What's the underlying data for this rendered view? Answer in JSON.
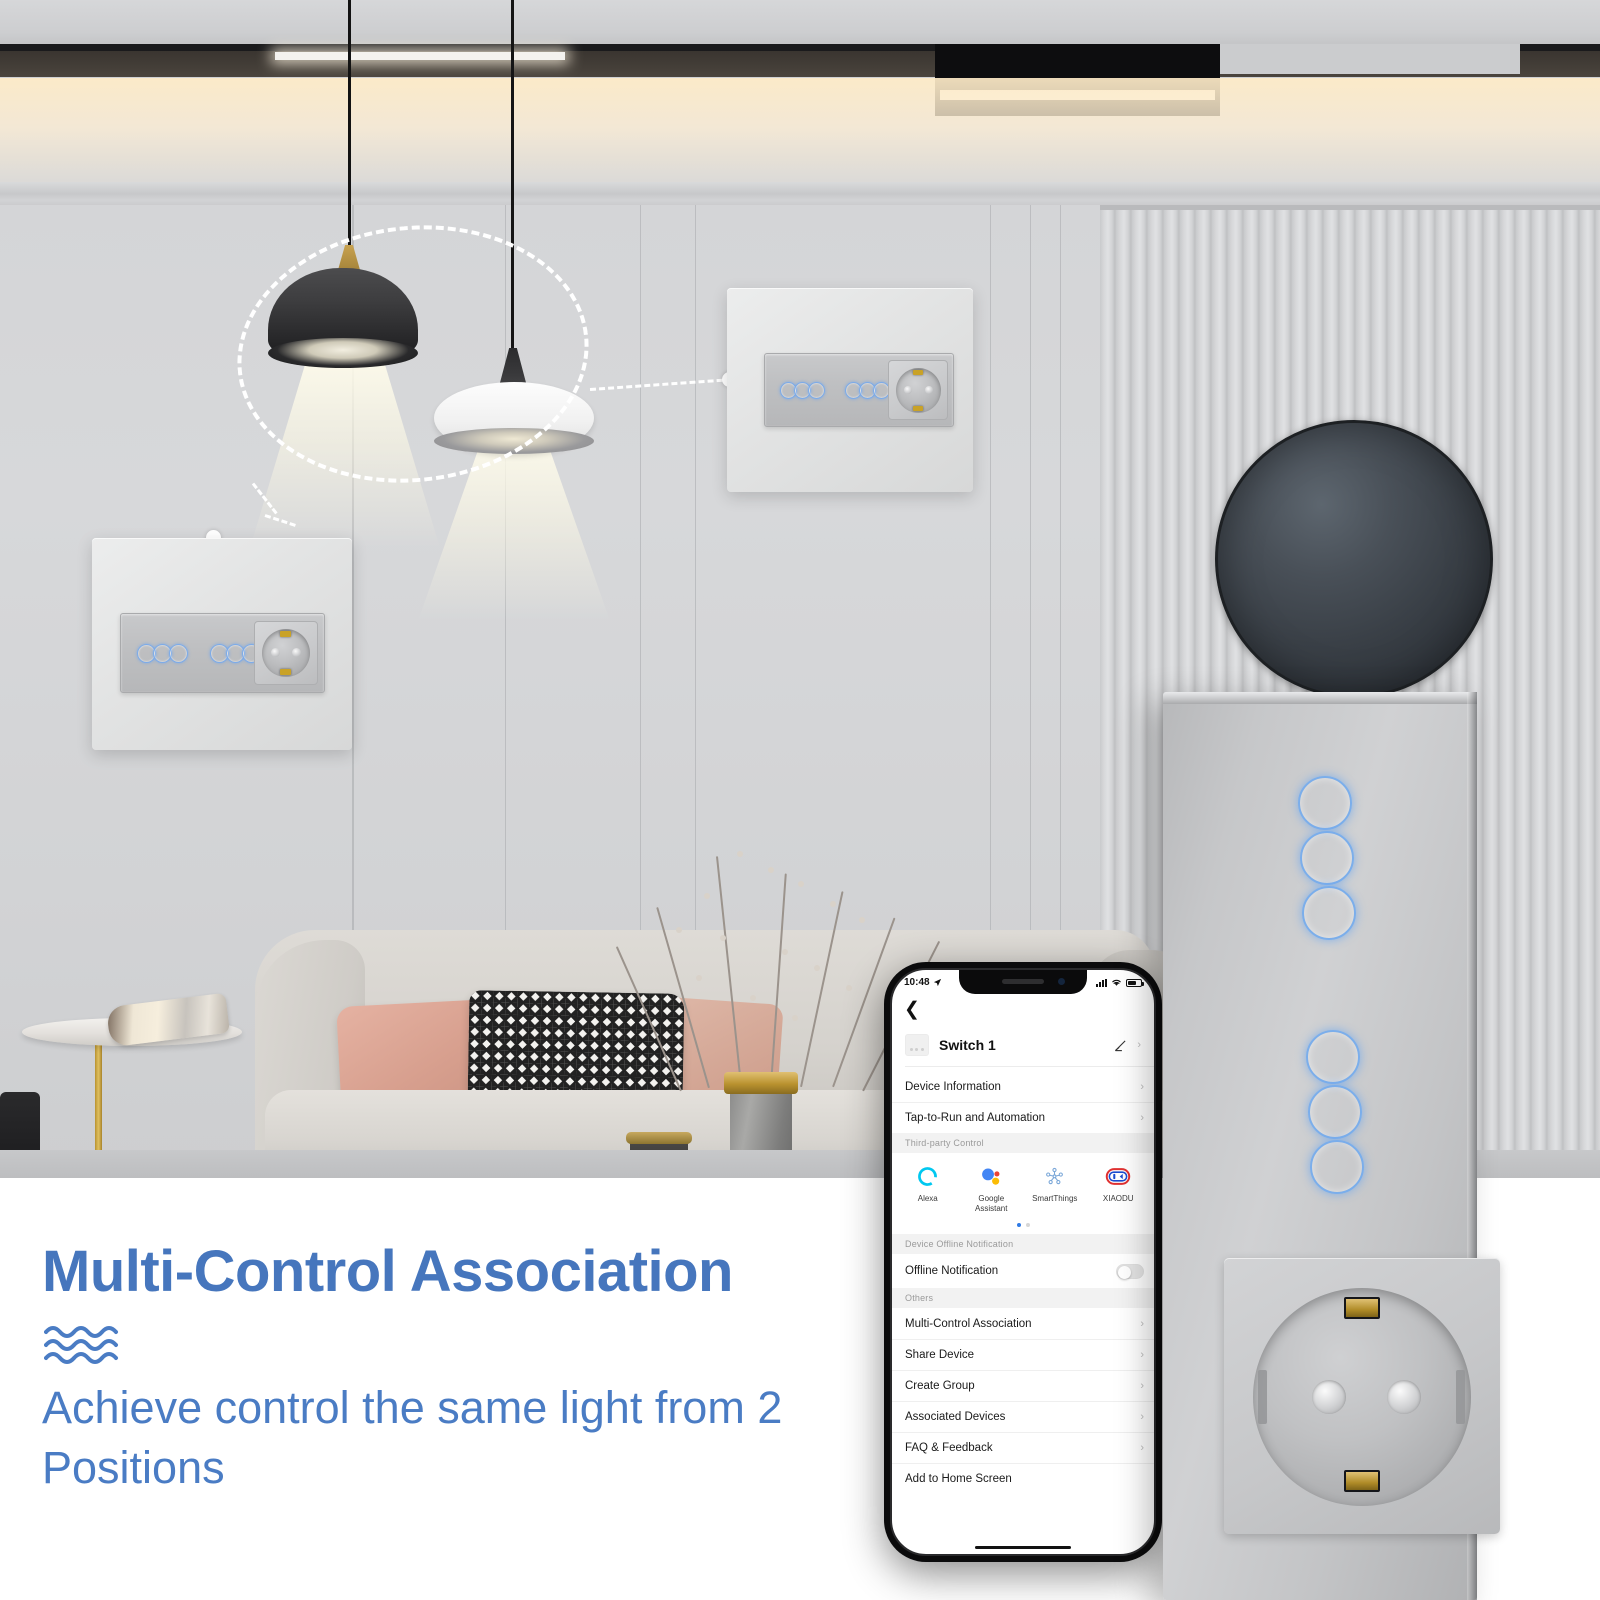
{
  "marketing": {
    "headline": "Multi-Control Association",
    "subline": "Achieve control the same light from 2 Positions",
    "wave_icon": "wave-lines-icon",
    "accent_color": "#4676bd",
    "subline_color": "#4a7cc4"
  },
  "phone": {
    "status_bar": {
      "time": "10:48",
      "location_icon": "location-arrow-icon",
      "signal_icon": "cellular-signal-icon",
      "wifi_icon": "wifi-icon",
      "battery_icon": "battery-icon"
    },
    "back_icon": "chevron-left-icon",
    "device": {
      "thumbnail_icon": "switch-panel-thumbnail-icon",
      "name": "Switch 1",
      "edit_icon": "pencil-edit-icon",
      "chevron": "›"
    },
    "rows_top": [
      {
        "label": "Device Information",
        "chevron": "›"
      },
      {
        "label": "Tap-to-Run and Automation",
        "chevron": "›"
      }
    ],
    "third_party": {
      "header": "Third-party Control",
      "items": [
        {
          "label": "Alexa",
          "icon": "alexa-icon",
          "color": "#00c8f0"
        },
        {
          "label": "Google Assistant",
          "icon": "google-assistant-icon",
          "color": "#4285f4"
        },
        {
          "label": "SmartThings",
          "icon": "smartthings-icon",
          "color": "#a8c8ea"
        },
        {
          "label": "XIAODU",
          "icon": "xiaodu-icon",
          "color": "#e03030"
        }
      ],
      "page_dots": 2,
      "active_dot": 0
    },
    "offline": {
      "header": "Device Offline Notification",
      "label": "Offline Notification",
      "toggle_state": "off",
      "toggle_icon": "toggle-switch-icon"
    },
    "others": {
      "header": "Others",
      "items": [
        {
          "label": "Multi-Control Association",
          "chevron": "›"
        },
        {
          "label": "Share Device",
          "chevron": "›"
        },
        {
          "label": "Create Group",
          "chevron": "›"
        },
        {
          "label": "Associated Devices",
          "chevron": "›"
        },
        {
          "label": "FAQ & Feedback",
          "chevron": "›"
        },
        {
          "label": "Add to Home Screen",
          "chevron": ""
        }
      ]
    },
    "home_indicator": "home-indicator-bar"
  },
  "scene": {
    "ceiling": {
      "strip_light": "linear-strip-light",
      "recessed_box": "recessed-ceiling-box"
    },
    "lamps": [
      {
        "name": "dark-pendant-lamp",
        "shade_color": "#3d3d3f",
        "beam": "warm-white"
      },
      {
        "name": "white-pendant-lamp",
        "shade_color": "#f4f4f4",
        "beam": "warm-white"
      }
    ],
    "highlight_ellipse": "dashed-highlight-ellipse",
    "wall_art": {
      "name": "round-wall-art",
      "color": "#3a4047"
    },
    "switch_panel_left": {
      "name": "wall-switch-panel-left",
      "touch_buttons": 6,
      "socket": "eu-schuko-socket"
    },
    "switch_panel_right": {
      "name": "wall-switch-panel-right",
      "touch_buttons": 6,
      "socket": "eu-schuko-socket"
    },
    "furniture": {
      "sofa": "grey-fabric-sofa",
      "pillows": [
        "pink-velvet-pillow",
        "houndstooth-pillow"
      ],
      "vase": "stone-vase-with-branches",
      "side_table": "marble-side-table",
      "magazine": "rolled-magazine",
      "cup": "dark-cup"
    }
  },
  "product": {
    "name": "smart-touch-switch-with-socket",
    "panel_finish": "brushed-silver-glass",
    "touch_rings_group_a": 3,
    "touch_rings_group_b": 3,
    "ring_glow_color": "#76acec",
    "socket_type": "eu-schuko-socket"
  }
}
